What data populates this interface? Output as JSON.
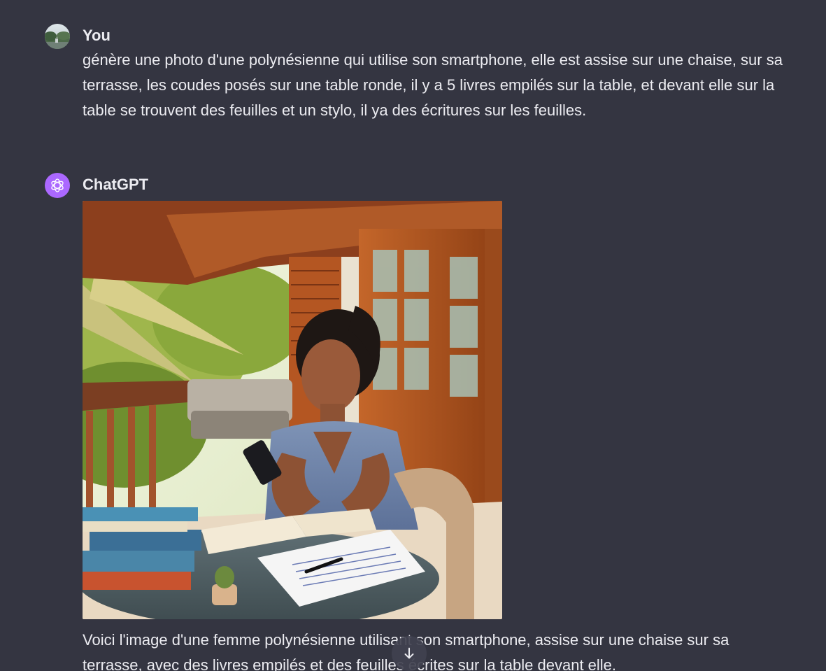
{
  "user_message": {
    "author": "You",
    "text": "génère une photo d'une polynésienne qui utilise son smartphone, elle est assise sur une chaise, sur sa terrasse, les coudes posés sur une table ronde, il y a 5 livres empilés sur la table, et devant elle sur la table se trouvent des feuilles et un stylo, il ya des écritures sur les feuilles."
  },
  "assistant_message": {
    "author": "ChatGPT",
    "image": {
      "alt": "Image générée : femme polynésienne utilisant son smartphone sur sa terrasse"
    },
    "text": "Voici l'image d'une femme polynésienne utilisant son smartphone, assise sur une chaise sur sa terrasse, avec des livres empilés et des feuilles écrites sur la table devant elle."
  },
  "icons": {
    "user_avatar": "user-avatar-photo",
    "assistant_avatar": "openai-logo-icon",
    "scroll_down": "arrow-down-icon"
  },
  "colors": {
    "background": "#343541",
    "text": "#ececf1",
    "assistant_avatar_bg": "#ab68ff",
    "scroll_button_bg": "#40414f"
  }
}
